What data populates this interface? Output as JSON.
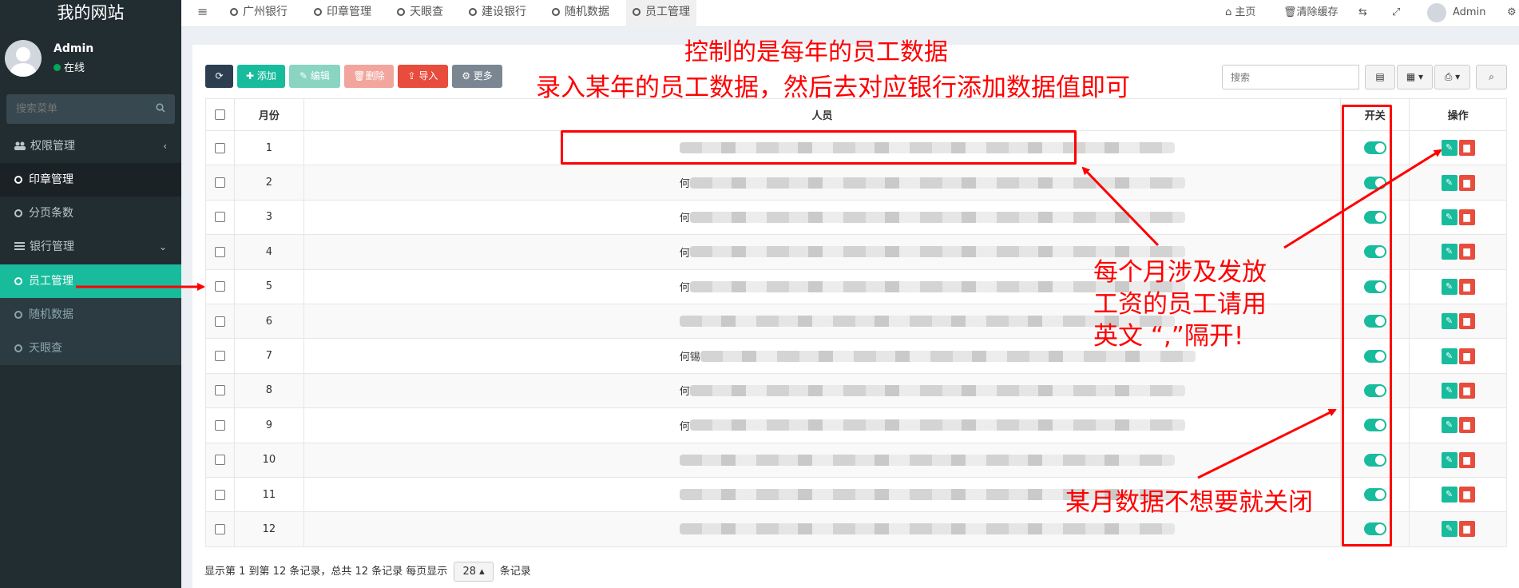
{
  "sidebar": {
    "title": "我的网站",
    "user_name": "Admin",
    "status": "在线",
    "search_placeholder": "搜索菜单",
    "items": [
      {
        "label": "权限管理",
        "icon": "users-icon"
      },
      {
        "label": "印章管理",
        "icon": "circle-icon"
      },
      {
        "label": "分页条数",
        "icon": "circle-icon"
      },
      {
        "label": "银行管理",
        "icon": "list-icon"
      },
      {
        "label": "员工管理",
        "icon": "circle-icon"
      },
      {
        "label": "随机数据",
        "icon": "circle-icon"
      },
      {
        "label": "天眼查",
        "icon": "circle-icon"
      }
    ]
  },
  "header": {
    "menu_icon": "menu-icon",
    "tabs": [
      "广州银行",
      "印章管理",
      "天眼查",
      "建设银行",
      "随机数据",
      "员工管理"
    ],
    "active_tab": "员工管理",
    "home": "主页",
    "clear_cache": "清除缓存",
    "admin": "Admin"
  },
  "toolbar": {
    "add": "添加",
    "edit": "编辑",
    "delete": "删除",
    "import": "导入",
    "more": "更多",
    "search_placeholder": "搜索"
  },
  "table": {
    "columns": [
      "月份",
      "人员",
      "开关",
      "操作"
    ],
    "rows": [
      {
        "month": "1",
        "people": ""
      },
      {
        "month": "2",
        "people": "何"
      },
      {
        "month": "3",
        "people": "何"
      },
      {
        "month": "4",
        "people": "何"
      },
      {
        "month": "5",
        "people": "何"
      },
      {
        "month": "6",
        "people": ""
      },
      {
        "month": "7",
        "people": "何锡"
      },
      {
        "month": "8",
        "people": "何"
      },
      {
        "month": "9",
        "people": "何"
      },
      {
        "month": "10",
        "people": ""
      },
      {
        "month": "11",
        "people": ""
      },
      {
        "month": "12",
        "people": ""
      }
    ]
  },
  "pager": {
    "prefix": "显示第 1 到第 12 条记录，总共 12 条记录 每页显示",
    "page_size": "28",
    "suffix": "条记录"
  },
  "annotations": {
    "title1": "控制的是每年的员工数据",
    "title2": "录入某年的员工数据，然后去对应银行添加数据值即可",
    "note_line1": "每个月涉及发放",
    "note_line2": "工资的员工请用",
    "note_line3": "英文 “,”隔开!",
    "toggle_note": "某月数据不想要就关闭"
  },
  "colors": {
    "sidebar_bg": "#222d32",
    "accent": "#18bc9c",
    "danger": "#e74c3c",
    "annotation": "#ff0000"
  }
}
